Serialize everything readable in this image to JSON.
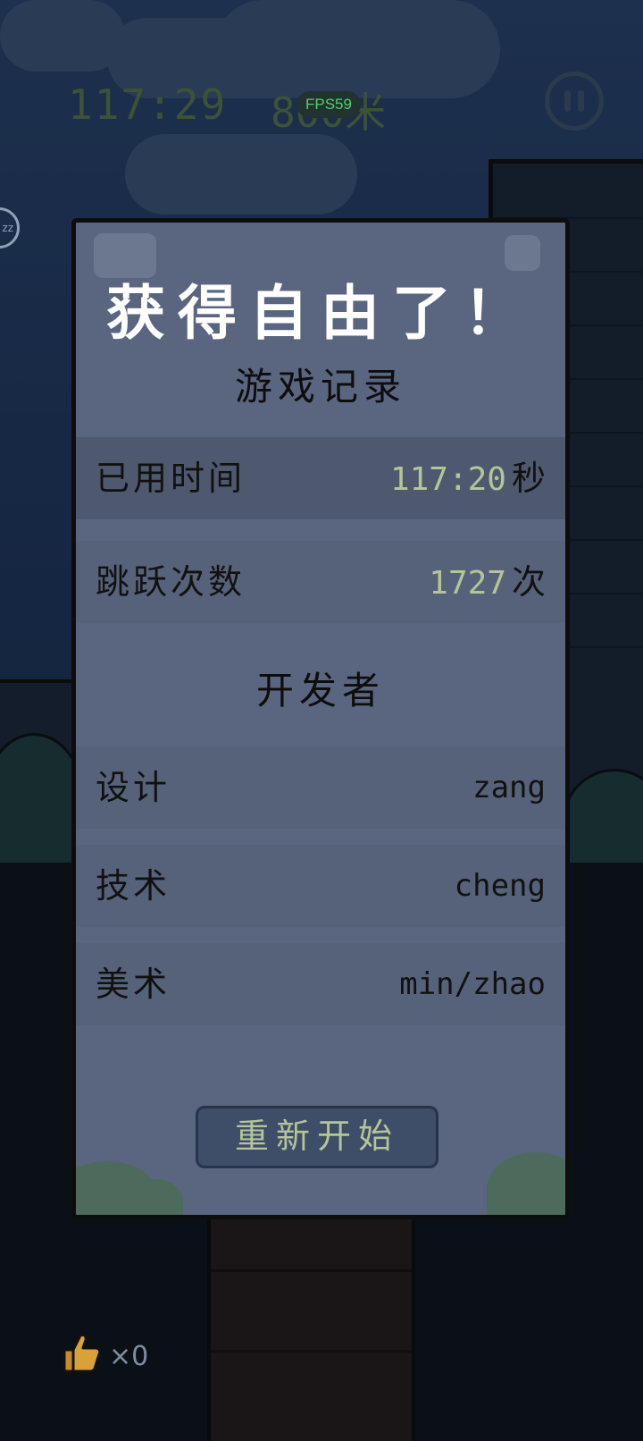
{
  "hud": {
    "timer": "117:29",
    "distance": "800米",
    "fps": "FPS59",
    "side_bubble": "zz"
  },
  "dialog": {
    "title": "获得自由了！",
    "record_title": "游戏记录",
    "time_row": {
      "label": "已用时间",
      "value": "117:20",
      "unit": "秒"
    },
    "jump_row": {
      "label": "跳跃次数",
      "value": "1727",
      "unit": "次"
    },
    "dev_title": "开发者",
    "devs": [
      {
        "role": "设计",
        "name": "zang"
      },
      {
        "role": "技术",
        "name": "cheng"
      },
      {
        "role": "美术",
        "name": "min/zhao"
      }
    ],
    "restart_label": "重新开始"
  },
  "inventory": {
    "count": "×0",
    "icon": "thumbs-up-icon"
  },
  "colors": {
    "panel": "#5a6680",
    "accent_number": "#b5c49a",
    "fps": "#4fd16a"
  }
}
